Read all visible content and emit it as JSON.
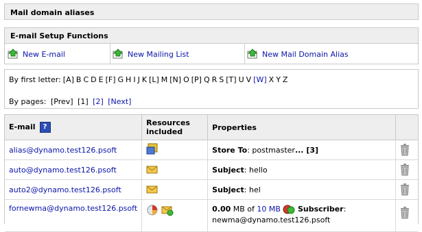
{
  "title": "Mail domain aliases",
  "setup": {
    "header": "E-mail Setup Functions",
    "functions": [
      {
        "label": "New E-mail"
      },
      {
        "label": "New Mailing List"
      },
      {
        "label": "New Mail Domain Alias"
      }
    ]
  },
  "filters": {
    "letter_label": "By first letter:",
    "letters": [
      "[A]",
      "B",
      "C",
      "D",
      "E",
      "[F]",
      "G",
      "H",
      "I",
      "J",
      "K",
      "[L]",
      "M",
      "[N]",
      "O",
      "[P]",
      "Q",
      "R",
      "S",
      "[T]",
      "U",
      "V",
      "[W]",
      "X",
      "Y",
      "Z"
    ],
    "letter_links": [
      22
    ],
    "pages_label": "By pages:",
    "prev": "[Prev]",
    "page1": "[1]",
    "page2": "[2]",
    "next": "[Next]"
  },
  "table": {
    "headers": {
      "email": "E-mail",
      "help": "?",
      "resources": "Resources included",
      "properties": "Properties"
    },
    "rows": [
      {
        "email": "alias@dynamo.test126.psoft",
        "prop_key": "Store To",
        "prop_val": ": postmaster",
        "prop_more": "... [3]"
      },
      {
        "email": "auto@dynamo.test126.psoft",
        "prop_key": "Subject",
        "prop_val": ": hello",
        "prop_more": ""
      },
      {
        "email": "auto2@dynamo.test126.psoft",
        "prop_key": "Subject",
        "prop_val": ": hel",
        "prop_more": ""
      },
      {
        "email": "fornewma@dynamo.test126.psoft",
        "used": "0.00",
        "mb_of": " MB of ",
        "quota": "10 MB",
        "sub_label": "Subscriber",
        "sub_tail": ":",
        "sub_email": "newma@dynamo.test126.psoft"
      }
    ]
  }
}
